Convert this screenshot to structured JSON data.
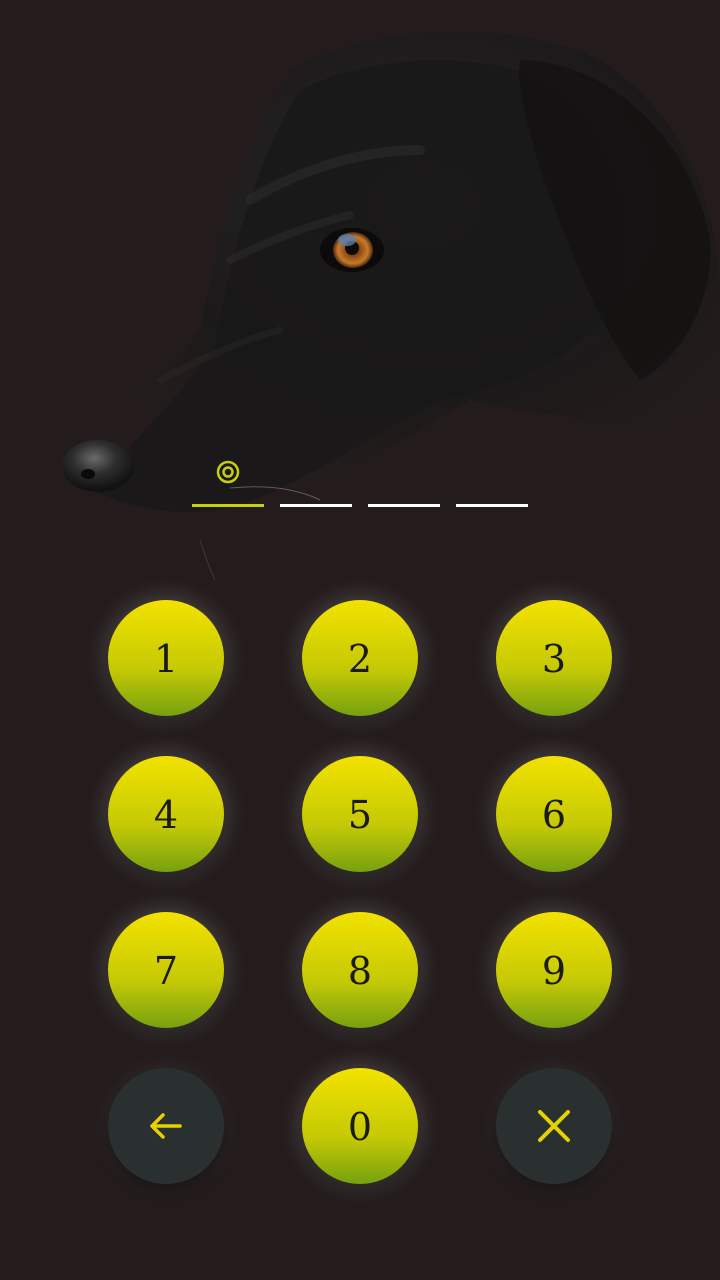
{
  "lock_screen": {
    "background": "dark-dog-photo",
    "accent_color": "#c7cf10",
    "pin": {
      "length": 4,
      "entered": 1,
      "indicator_icon": "target-circle-icon"
    },
    "keypad": {
      "digits": [
        "1",
        "2",
        "3",
        "4",
        "5",
        "6",
        "7",
        "8",
        "9",
        "0"
      ],
      "backspace_icon": "arrow-left-icon",
      "clear_icon": "close-x-icon"
    }
  }
}
